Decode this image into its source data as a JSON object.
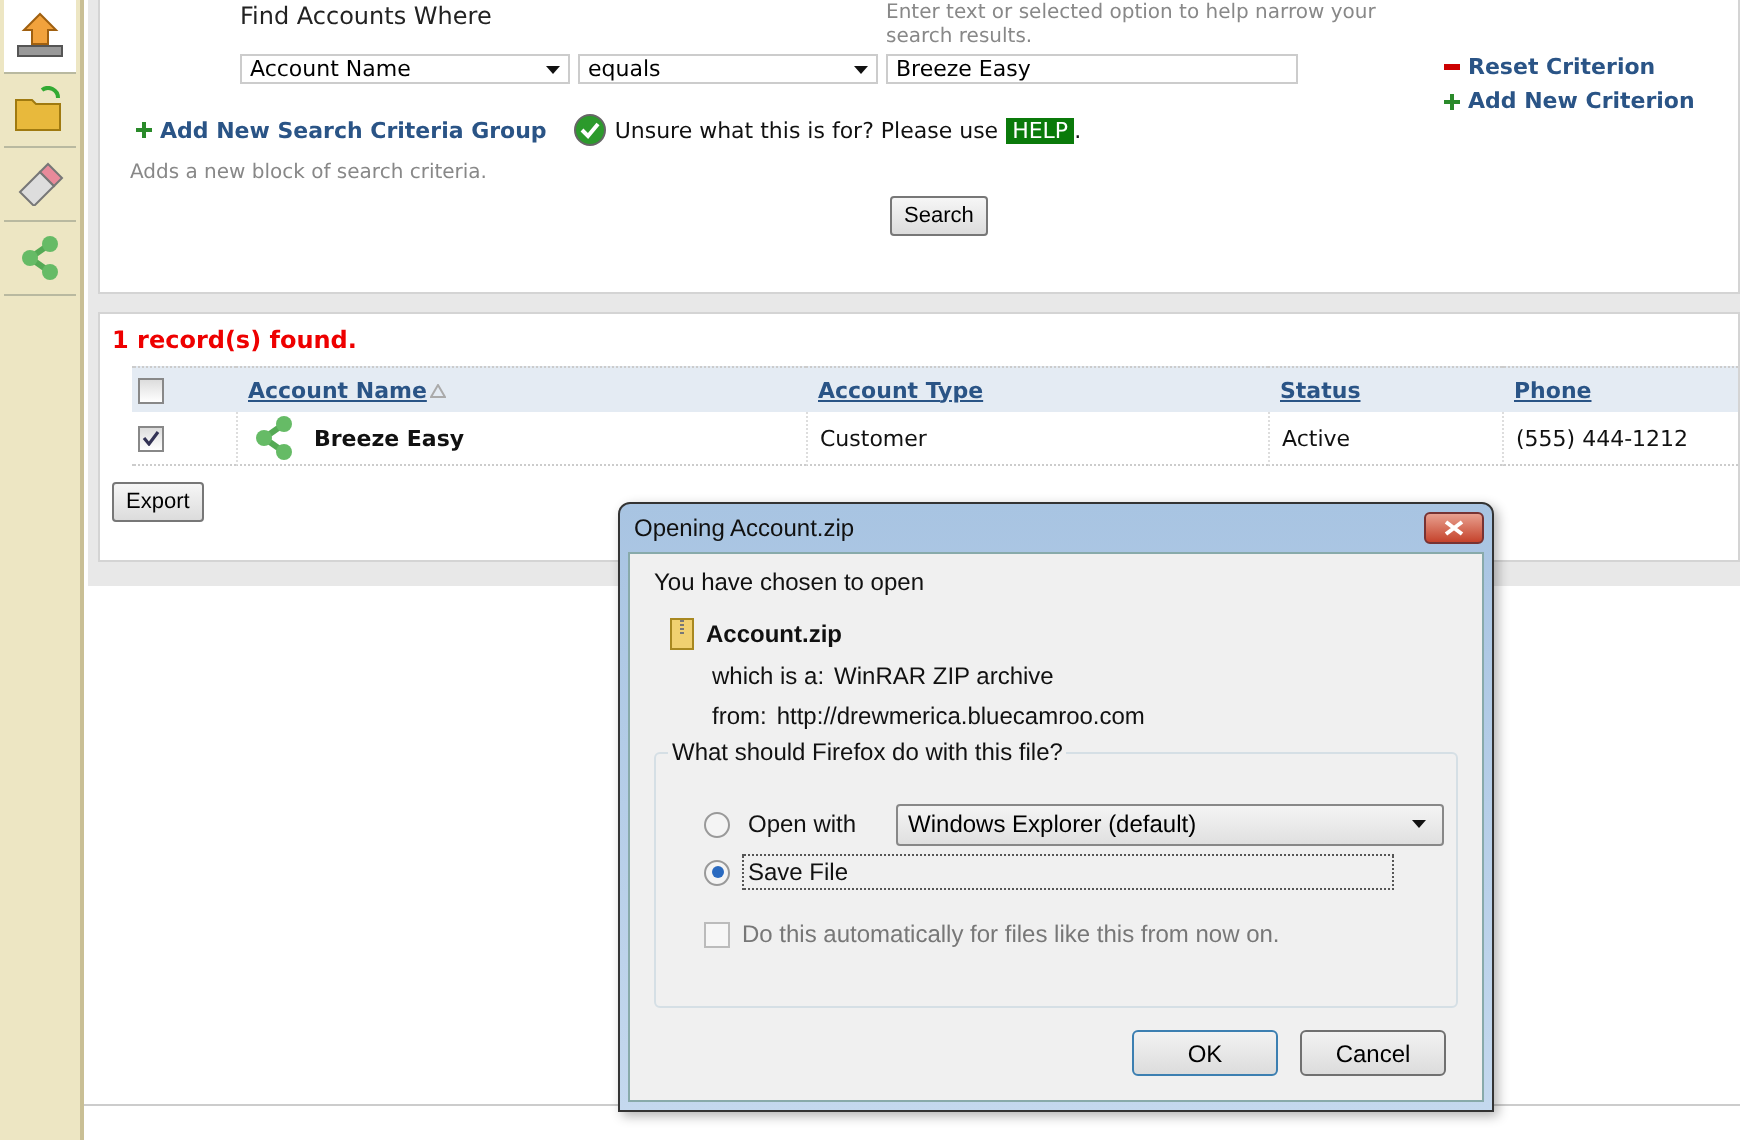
{
  "sidebar": {
    "items": [
      {
        "kind": "upload",
        "selected": true
      },
      {
        "kind": "folder",
        "selected": false
      },
      {
        "kind": "eraser",
        "selected": false
      },
      {
        "kind": "share",
        "selected": false
      }
    ]
  },
  "search": {
    "title": "Find Accounts Where",
    "hint": "Enter text or selected option to help narrow your search results.",
    "criterion": {
      "field": "Account Name",
      "operator": "equals",
      "value": "Breeze Easy"
    },
    "links": [
      {
        "kind": "remove",
        "label": "Reset Criterion"
      },
      {
        "kind": "add",
        "label": "Add New Criterion"
      }
    ],
    "add_group": {
      "label": "Add New Search Criteria Group",
      "description": "Adds a new block of search criteria."
    },
    "help": {
      "text": "Unsure what this is for? Please use",
      "badge": "HELP",
      "after": "."
    },
    "button": "Search"
  },
  "results": {
    "count": "1 record(s) found.",
    "columns": [
      {
        "label": "Account Name",
        "sorted": true
      },
      {
        "label": "Account Type",
        "sorted": false
      },
      {
        "label": "Status",
        "sorted": false
      },
      {
        "label": "Phone",
        "sorted": false
      }
    ],
    "header_checked": false,
    "rows": [
      {
        "checked": true,
        "cells": [
          "Breeze Easy",
          "Customer",
          "Active",
          "(555) 444-1212"
        ]
      }
    ],
    "export": "Export"
  },
  "dialog": {
    "title": "Opening Account.zip",
    "intro": "You have chosen to open",
    "file": "Account.zip",
    "details": [
      {
        "label": "which is a:",
        "value": "WinRAR ZIP archive"
      },
      {
        "label": "from:",
        "value": "http://drewmerica.bluecamroo.com"
      }
    ],
    "question": "What should Firefox do with this file?",
    "options": [
      {
        "kind": "open",
        "label": "Open with",
        "selected": false,
        "app": "Windows Explorer (default)"
      },
      {
        "kind": "save",
        "label": "Save File",
        "selected": true
      }
    ],
    "auto": {
      "label": "Do this automatically for files like this from now on.",
      "checked": false,
      "disabled": true
    },
    "buttons": [
      {
        "label": "OK",
        "default": true
      },
      {
        "label": "Cancel",
        "default": false
      }
    ]
  }
}
